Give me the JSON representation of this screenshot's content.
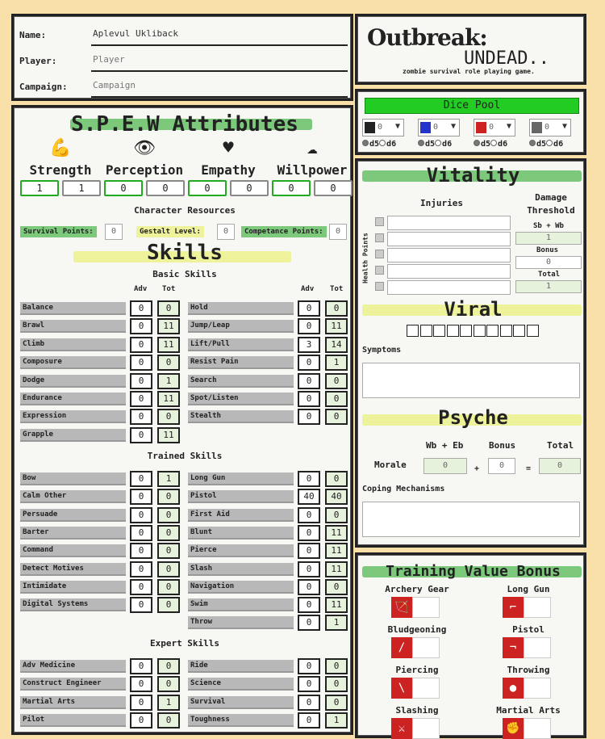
{
  "header": {
    "name_label": "Name:",
    "name_value": "Aplevul Ukliback",
    "player_label": "Player:",
    "player_placeholder": "Player",
    "campaign_label": "Campaign:",
    "campaign_placeholder": "Campaign"
  },
  "logo": {
    "title_a": "Outbreak:",
    "title_b": "UNDEAD..",
    "tagline": "zombie survival role playing game."
  },
  "attributes": {
    "title": "S.P.E.W Attributes",
    "items": [
      {
        "name": "Strength",
        "icon": "flexed-arm-icon",
        "glyph": "💪",
        "a": "1",
        "b": "1"
      },
      {
        "name": "Perception",
        "icon": "eye-icon",
        "glyph": "👁",
        "a": "0",
        "b": "0"
      },
      {
        "name": "Empathy",
        "icon": "heart-icon",
        "glyph": "♥",
        "a": "0",
        "b": "0"
      },
      {
        "name": "Willpower",
        "icon": "brain-icon",
        "glyph": "☁",
        "a": "0",
        "b": "0"
      }
    ]
  },
  "resources": {
    "title": "Character Resources",
    "survival_label": "Survival Points:",
    "survival": "0",
    "gestalt_label": "Gestalt Level:",
    "gestalt": "0",
    "competence_label": "Competance Points:",
    "competence": "0"
  },
  "skills": {
    "title": "Skills",
    "adv_header": "Adv",
    "tot_header": "Tot",
    "basic_title": "Basic Skills",
    "basic_left": [
      [
        "Balance",
        "0",
        "0"
      ],
      [
        "Brawl",
        "0",
        "11"
      ],
      [
        "Climb",
        "0",
        "11"
      ],
      [
        "Composure",
        "0",
        "0"
      ],
      [
        "Dodge",
        "0",
        "1"
      ],
      [
        "Endurance",
        "0",
        "11"
      ],
      [
        "Expression",
        "0",
        "0"
      ],
      [
        "Grapple",
        "0",
        "11"
      ]
    ],
    "basic_right": [
      [
        "Hold",
        "0",
        "0"
      ],
      [
        "Jump/Leap",
        "0",
        "11"
      ],
      [
        "Lift/Pull",
        "3",
        "14"
      ],
      [
        "Resist Pain",
        "0",
        "1"
      ],
      [
        "Search",
        "0",
        "0"
      ],
      [
        "Spot/Listen",
        "0",
        "0"
      ],
      [
        "Stealth",
        "0",
        "0"
      ]
    ],
    "trained_title": "Trained Skills",
    "trained_left": [
      [
        "Bow",
        "0",
        "1"
      ],
      [
        "Calm Other",
        "0",
        "0"
      ],
      [
        "Persuade",
        "0",
        "0"
      ],
      [
        "Barter",
        "0",
        "0"
      ],
      [
        "Command",
        "0",
        "0"
      ],
      [
        "Detect Motives",
        "0",
        "0"
      ],
      [
        "Intimidate",
        "0",
        "0"
      ],
      [
        "Digital Systems",
        "0",
        "0"
      ]
    ],
    "trained_right": [
      [
        "Long Gun",
        "0",
        "0"
      ],
      [
        "Pistol",
        "40",
        "40"
      ],
      [
        "First Aid",
        "0",
        "0"
      ],
      [
        "Blunt",
        "0",
        "11"
      ],
      [
        "Pierce",
        "0",
        "11"
      ],
      [
        "Slash",
        "0",
        "11"
      ],
      [
        "Navigation",
        "0",
        "0"
      ],
      [
        "Swim",
        "0",
        "11"
      ],
      [
        "Throw",
        "0",
        "1"
      ]
    ],
    "expert_title": "Expert Skills",
    "expert_left": [
      [
        "Adv Medicine",
        "0",
        "0"
      ],
      [
        "Construct Engineer",
        "0",
        "0"
      ],
      [
        "Martial Arts",
        "0",
        "1"
      ],
      [
        "Pilot",
        "0",
        "0"
      ]
    ],
    "expert_right": [
      [
        "Ride",
        "0",
        "0"
      ],
      [
        "Science",
        "0",
        "0"
      ],
      [
        "Survival",
        "0",
        "0"
      ],
      [
        "Toughness",
        "0",
        "1"
      ]
    ]
  },
  "dice_pool": {
    "title": "Dice Pool",
    "slots": [
      {
        "icon": "black-die-icon",
        "color": "#222222",
        "value": "0"
      },
      {
        "icon": "blue-die-icon",
        "color": "#2233cc",
        "value": "0"
      },
      {
        "icon": "red-die-icon",
        "color": "#cc2222",
        "value": "0"
      },
      {
        "icon": "figure-icon",
        "color": "#666666",
        "value": "0"
      }
    ],
    "d5": "d5",
    "d6": "d6"
  },
  "vitality": {
    "title": "Vitality",
    "injuries": "Injuries",
    "damage_threshold": "Damage Threshold",
    "health_points": "Health Points",
    "sb_wb": "Sb + Wb",
    "sb_wb_value": "1",
    "bonus": "Bonus",
    "bonus_value": "0",
    "total": "Total",
    "total_value": "1"
  },
  "viral": {
    "title": "Viral",
    "symptoms": "Symptoms"
  },
  "psyche": {
    "title": "Psyche",
    "wb_eb": "Wb + Eb",
    "bonus": "Bonus",
    "total": "Total",
    "morale": "Morale",
    "wb_eb_value": "0",
    "bonus_value": "0",
    "total_value": "0",
    "plus": "+",
    "equals": "=",
    "coping": "Coping Mechanisms"
  },
  "training": {
    "title": "Training Value Bonus",
    "items": [
      {
        "name": "Archery Gear",
        "icon": "archer-icon",
        "glyph": "🏹"
      },
      {
        "name": "Long Gun",
        "icon": "rifle-icon",
        "glyph": "⌐"
      },
      {
        "name": "Bludgeoning",
        "icon": "club-icon",
        "glyph": "/"
      },
      {
        "name": "Pistol",
        "icon": "pistol-icon",
        "glyph": "¬"
      },
      {
        "name": "Piercing",
        "icon": "spear-icon",
        "glyph": "\\"
      },
      {
        "name": "Throwing",
        "icon": "grenade-icon",
        "glyph": "●"
      },
      {
        "name": "Slashing",
        "icon": "sword-icon",
        "glyph": "⚔"
      },
      {
        "name": "Martial Arts",
        "icon": "fist-icon",
        "glyph": "✊"
      }
    ]
  }
}
